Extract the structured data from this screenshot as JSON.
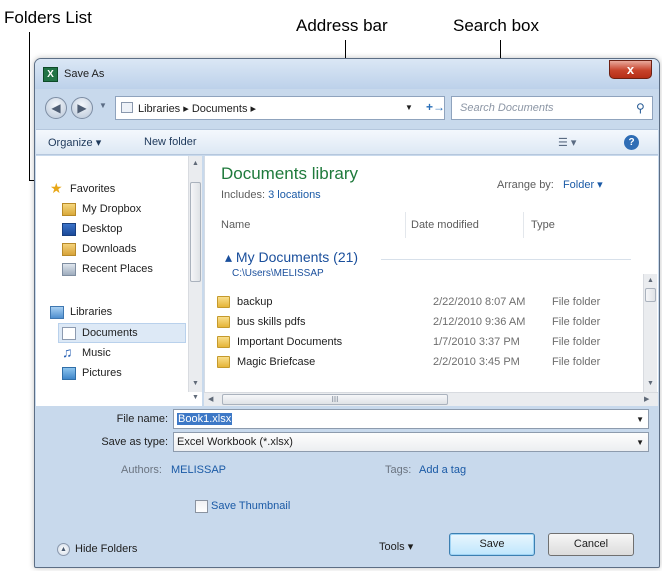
{
  "callouts": {
    "folders_list": "Folders List",
    "address_bar": "Address bar",
    "search_box": "Search box"
  },
  "window": {
    "title": "Save As",
    "title_icon": "excel-icon",
    "close_label": "x"
  },
  "address": {
    "path": "Libraries  ▸  Documents  ▸",
    "prefix": "▸",
    "refresh_label": "+→"
  },
  "search": {
    "placeholder": "Search Documents"
  },
  "toolbar": {
    "organize": "Organize ▾",
    "new_folder": "New folder",
    "help_label": "?"
  },
  "sidebar": {
    "items": [
      {
        "label": "Favorites",
        "icon": "star-icon"
      },
      {
        "label": "My Dropbox",
        "icon": "dropbox-icon"
      },
      {
        "label": "Desktop",
        "icon": "desktop-icon"
      },
      {
        "label": "Downloads",
        "icon": "downloads-icon"
      },
      {
        "label": "Recent Places",
        "icon": "recent-places-icon"
      },
      {
        "label": "Libraries",
        "icon": "libraries-icon"
      },
      {
        "label": "Documents",
        "icon": "documents-icon",
        "selected": true
      },
      {
        "label": "Music",
        "icon": "music-icon"
      },
      {
        "label": "Pictures",
        "icon": "pictures-icon"
      }
    ]
  },
  "library": {
    "title": "Documents library",
    "includes_label": "Includes:",
    "includes_link": "3 locations",
    "arrange_label": "Arrange by:",
    "arrange_value": "Folder ▾"
  },
  "columns": {
    "name": "Name",
    "date": "Date modified",
    "type": "Type"
  },
  "group": {
    "title": "▴  My Documents (21)",
    "path": "C:\\Users\\MELISSAP"
  },
  "files": [
    {
      "name": "backup",
      "date": "2/22/2010 8:07 AM",
      "type": "File folder"
    },
    {
      "name": "bus skills pdfs",
      "date": "2/12/2010 9:36 AM",
      "type": "File folder"
    },
    {
      "name": "Important Documents",
      "date": "1/7/2010 3:37 PM",
      "type": "File folder"
    },
    {
      "name": "Magic Briefcase",
      "date": "2/2/2010 3:45 PM",
      "type": "File folder"
    }
  ],
  "hscroll": {
    "grip": "III"
  },
  "form": {
    "file_name_label": "File name:",
    "file_name_value": "Book1.xlsx",
    "save_type_label": "Save as type:",
    "save_type_value": "Excel Workbook (*.xlsx)",
    "authors_label": "Authors:",
    "authors_value": "MELISSAP",
    "tags_label": "Tags:",
    "tags_value": "Add a tag",
    "thumbnail_label": "Save Thumbnail",
    "thumbnail_checked": false
  },
  "footer": {
    "hide_folders": "Hide Folders",
    "tools": "Tools  ▾",
    "save": "Save",
    "cancel": "Cancel"
  }
}
